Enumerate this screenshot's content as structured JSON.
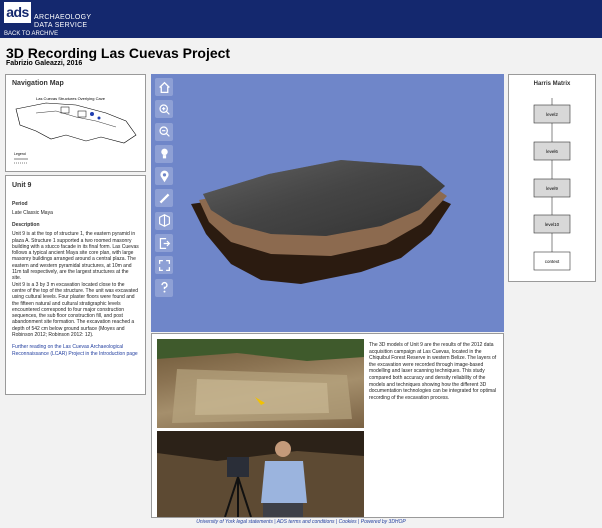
{
  "header": {
    "logo": "ads",
    "org_line1": "ARCHAEOLOGY",
    "org_line2": "DATA SERVICE",
    "back_link": "BACK TO ARCHIVE"
  },
  "page": {
    "title": "3D Recording Las Cuevas Project",
    "author": "Fabrizio Galeazzi, 2016"
  },
  "nav_map": {
    "heading": "Navigation Map",
    "map_caption": "Las Cuevas Structures Overlying Cave",
    "legend": "Legend"
  },
  "unit": {
    "heading": "Unit 9",
    "period_label": "Period",
    "period_value": "Late Classic Maya",
    "description_label": "Description",
    "description_p1": "Unit 9 is at the top of structure 1, the eastern pyramid in plaza A. Structure 1 supported a two roomed masonry building with a stucco facade in its final form. Las Cuevas follows a typical ancient Maya site core plan, with large masonry buildings arranged around a central plaza. The eastern and western pyramidal structures, at 10m and 11m tall respectively, are the largest structures at the site.",
    "description_p2": "Unit 9 is a 3 by 3 m excavation located close to the centre of the top of the structure. The unit was excavated using cultural levels. Four plaster floors were found and the fifteen natural and cultural stratigraphic levels encountered correspond to four major construction sequences, the sub floor construction fill, and post abandonment site formation. The excavation reached a depth of 542 cm below ground surface (Moyes and Robinson 2012; Robinson 2012: 12).",
    "further_link": "Further reading on the Las Cuevas Archaeological Reconnaissance (LCAR) Project in the Introduction page"
  },
  "viewer": {
    "tools": [
      "home-icon",
      "zoom-in-icon",
      "zoom-out-icon",
      "light-icon",
      "pick-point-icon",
      "measure-icon",
      "sections-icon",
      "camera-icon",
      "fullscreen-icon",
      "help-icon"
    ]
  },
  "harris": {
    "heading": "Harris Matrix",
    "nodes": [
      "level2",
      "level6",
      "level9",
      "level10",
      "context"
    ]
  },
  "lower": {
    "description": "The 3D models of Unit 9 are the results of the 2012 data acquisition campaign at Las Cuevas, located in the Chiquibul Forest Reserve in western Belize. The layers of the excavation were recorded through image-based modelling and laser scanning techniques. This study compared both accuracy and density reliability of the models and techniques showing how the different 3D documentation technologies can be integrated for optimal recording of the excavation process."
  },
  "footer": {
    "text": "University of York legal statements | ADS terms and conditions | Cookies | Powered by 3DHOP"
  },
  "colors": {
    "header_blue": "#14286e",
    "viewer_bg": "#6f86c9",
    "node_fill": "#d8d8d8"
  }
}
